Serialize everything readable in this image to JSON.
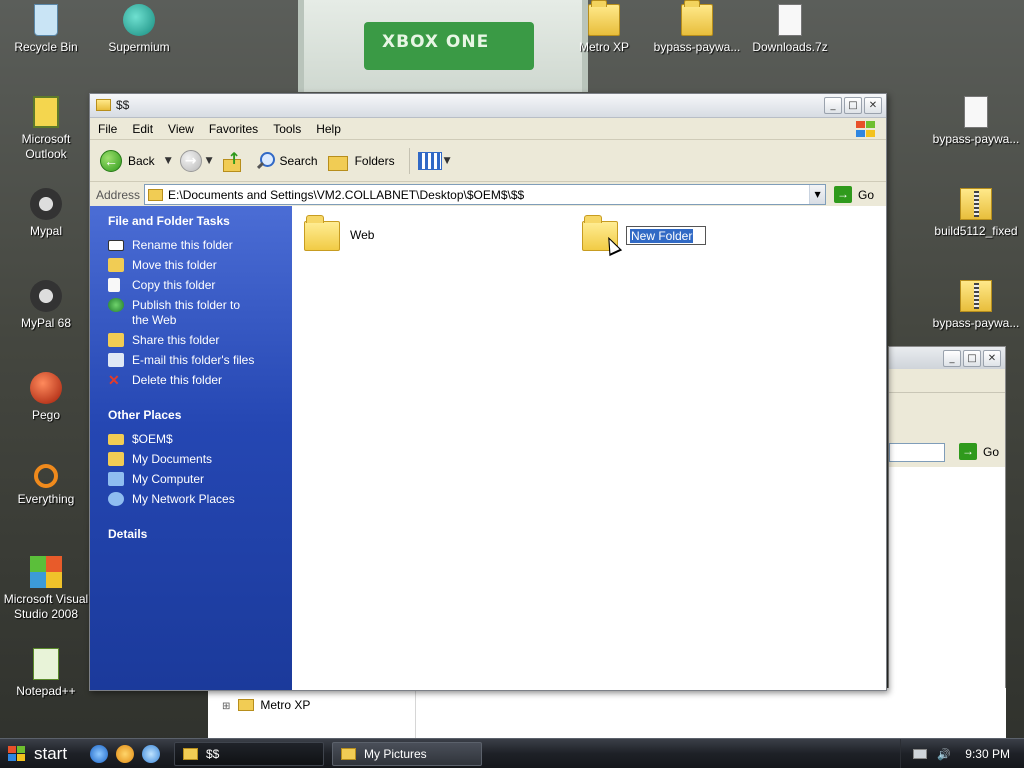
{
  "desktop": {
    "icons": [
      {
        "label": "Recycle Bin"
      },
      {
        "label": "Supermium"
      },
      {
        "label": "Metro XP"
      },
      {
        "label": "bypass-paywa..."
      },
      {
        "label": "Downloads.7z"
      },
      {
        "label": "Microsoft Outlook"
      },
      {
        "label": "Mypal"
      },
      {
        "label": "MyPal 68"
      },
      {
        "label": "Pego"
      },
      {
        "label": "Everything"
      },
      {
        "label": "Microsoft Visual Studio 2008"
      },
      {
        "label": "Notepad++"
      },
      {
        "label": "bypass-paywa..."
      },
      {
        "label": "build5112_fixed"
      },
      {
        "label": "bypass-paywa..."
      }
    ],
    "wallpaper_text": "XBOX ONE"
  },
  "window": {
    "title": "$$",
    "menu": [
      "File",
      "Edit",
      "View",
      "Favorites",
      "Tools",
      "Help"
    ],
    "toolbar": {
      "back": "Back",
      "search": "Search",
      "folders": "Folders"
    },
    "address": {
      "label": "Address",
      "value": "E:\\Documents and Settings\\VM2.COLLABNET\\Desktop\\$OEM$\\$$",
      "go": "Go"
    },
    "task_pane": {
      "file_tasks": {
        "title": "File and Folder Tasks",
        "items": [
          {
            "label": "Rename this folder",
            "icon": "rename-icon"
          },
          {
            "label": "Move this folder",
            "icon": "move-icon"
          },
          {
            "label": "Copy this folder",
            "icon": "copy-icon"
          },
          {
            "label": "Publish this folder to the Web",
            "icon": "globe-icon"
          },
          {
            "label": "Share this folder",
            "icon": "share-icon"
          },
          {
            "label": "E-mail this folder's files",
            "icon": "email-icon"
          },
          {
            "label": "Delete this folder",
            "icon": "delete-icon"
          }
        ]
      },
      "other_places": {
        "title": "Other Places",
        "items": [
          {
            "label": "$OEM$",
            "icon": "folder-icon"
          },
          {
            "label": "My Documents",
            "icon": "my-documents-icon"
          },
          {
            "label": "My Computer",
            "icon": "my-computer-icon"
          },
          {
            "label": "My Network Places",
            "icon": "network-icon"
          }
        ]
      },
      "details": {
        "title": "Details"
      }
    },
    "items": [
      {
        "name": "Web"
      },
      {
        "name": "New Folder",
        "renaming": true
      }
    ]
  },
  "background_window": {
    "go": "Go",
    "tree_item": "Metro XP"
  },
  "taskbar": {
    "start": "start",
    "tasks": [
      {
        "label": "$$",
        "active": true
      },
      {
        "label": "My Pictures",
        "active": false
      }
    ],
    "clock": "9:30 PM"
  },
  "colors": {
    "taskpane_blue": "#2547b3",
    "selection_blue": "#316ac5",
    "go_green": "#2f9a1c"
  }
}
